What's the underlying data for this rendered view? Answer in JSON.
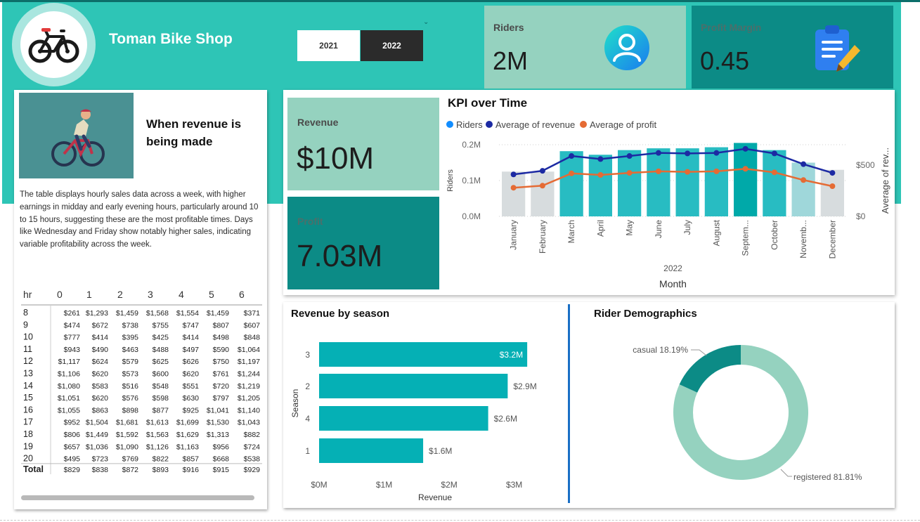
{
  "header": {
    "shop_title": "Toman Bike Shop",
    "year_buttons": [
      "2021",
      "2022"
    ],
    "caret": "⌄"
  },
  "kpis": {
    "riders": {
      "label": "Riders",
      "value": "2M"
    },
    "profit_margin": {
      "label": "Profit Margin",
      "value": "0.45"
    },
    "revenue": {
      "label": "Revenue",
      "value": "$10M"
    },
    "profit": {
      "label": "Profit",
      "value": "7.03M"
    }
  },
  "info": {
    "heading": "When revenue is being made",
    "body": "The table displays hourly sales data across a week, with higher earnings in midday and early evening hours, particularly around 10 to 15 hours, suggesting these are the most profitable times. Days like Wednesday and Friday show notably higher sales, indicating variable profitability across the week."
  },
  "colors": {
    "banner": "#2ec5b6",
    "bar": "#05b0b5",
    "revenue_line": "#1c2aa3",
    "profit_line": "#e56b34",
    "riders_legend": "#118dff",
    "donut_registered": "#95d2bf",
    "donut_casual": "#0c8b86"
  },
  "icons": [
    "bicycle-icon",
    "cyclist-icon",
    "user-icon",
    "clipboard-icon"
  ],
  "hour_table": {
    "header": [
      "hr",
      "0",
      "1",
      "2",
      "3",
      "4",
      "5",
      "6"
    ],
    "rows": [
      [
        "8",
        "$261",
        "$1,293",
        "$1,459",
        "$1,568",
        "$1,554",
        "$1,459",
        "$371"
      ],
      [
        "9",
        "$474",
        "$672",
        "$738",
        "$755",
        "$747",
        "$807",
        "$607"
      ],
      [
        "10",
        "$777",
        "$414",
        "$395",
        "$425",
        "$414",
        "$498",
        "$848"
      ],
      [
        "11",
        "$943",
        "$490",
        "$463",
        "$488",
        "$497",
        "$590",
        "$1,064"
      ],
      [
        "12",
        "$1,117",
        "$624",
        "$579",
        "$625",
        "$626",
        "$750",
        "$1,197"
      ],
      [
        "13",
        "$1,106",
        "$620",
        "$573",
        "$600",
        "$620",
        "$761",
        "$1,244"
      ],
      [
        "14",
        "$1,080",
        "$583",
        "$516",
        "$548",
        "$551",
        "$720",
        "$1,219"
      ],
      [
        "15",
        "$1,051",
        "$620",
        "$576",
        "$598",
        "$630",
        "$797",
        "$1,205"
      ],
      [
        "16",
        "$1,055",
        "$863",
        "$898",
        "$877",
        "$925",
        "$1,041",
        "$1,140"
      ],
      [
        "17",
        "$952",
        "$1,504",
        "$1,681",
        "$1,613",
        "$1,699",
        "$1,530",
        "$1,043"
      ],
      [
        "18",
        "$806",
        "$1,449",
        "$1,592",
        "$1,563",
        "$1,629",
        "$1,313",
        "$882"
      ],
      [
        "19",
        "$657",
        "$1,036",
        "$1,090",
        "$1,126",
        "$1,163",
        "$956",
        "$724"
      ],
      [
        "20",
        "$495",
        "$723",
        "$769",
        "$822",
        "$857",
        "$668",
        "$538"
      ]
    ],
    "total": [
      "Total",
      "$829",
      "$838",
      "$872",
      "$893",
      "$916",
      "$915",
      "$929"
    ]
  },
  "chart_data": [
    {
      "type": "bar",
      "title": "KPI over Time",
      "xlabel": "Month",
      "x_group_label": "2022",
      "ylabel": "Riders",
      "y2label": "Average of rev...",
      "legend_position": "top-left",
      "categories": [
        "January",
        "February",
        "March",
        "April",
        "May",
        "June",
        "July",
        "August",
        "Septem...",
        "October",
        "Novemb...",
        "December"
      ],
      "series": [
        {
          "name": "Riders",
          "type": "bar",
          "values": [
            0.125,
            0.125,
            0.182,
            0.172,
            0.185,
            0.19,
            0.19,
            0.193,
            0.205,
            0.185,
            0.15,
            0.13
          ]
        },
        {
          "name": "Average of revenue",
          "type": "line",
          "axis": "secondary",
          "values": [
            410,
            445,
            590,
            560,
            590,
            620,
            615,
            620,
            660,
            615,
            510,
            425
          ]
        },
        {
          "name": "Average of profit",
          "type": "line",
          "axis": "secondary",
          "values": [
            280,
            300,
            420,
            405,
            425,
            440,
            435,
            440,
            465,
            430,
            355,
            295
          ]
        }
      ],
      "ytick_labels": [
        "0.0M",
        "0.1M",
        "0.2M"
      ],
      "ylim": [
        0,
        0.2
      ],
      "y2tick_labels": [
        "$0",
        "$500"
      ],
      "y2lim": [
        0,
        700
      ],
      "grid": true
    },
    {
      "type": "bar",
      "orientation": "horizontal",
      "title": "Revenue by season",
      "xlabel": "Revenue",
      "ylabel": "Season",
      "categories": [
        "3",
        "2",
        "4",
        "1"
      ],
      "values": [
        3.2,
        2.9,
        2.6,
        1.6
      ],
      "data_labels": [
        "$3.2M",
        "$2.9M",
        "$2.6M",
        "$1.6M"
      ],
      "xtick_labels": [
        "$0M",
        "$1M",
        "$2M",
        "$3M"
      ],
      "xlim": [
        0,
        3.35
      ],
      "grid": false
    },
    {
      "type": "pie",
      "donut": true,
      "title": "Rider Demographics",
      "categories": [
        "registered",
        "casual"
      ],
      "values": [
        81.81,
        18.19
      ],
      "data_labels": [
        "registered 81.81%",
        "casual 18.19%"
      ]
    }
  ]
}
